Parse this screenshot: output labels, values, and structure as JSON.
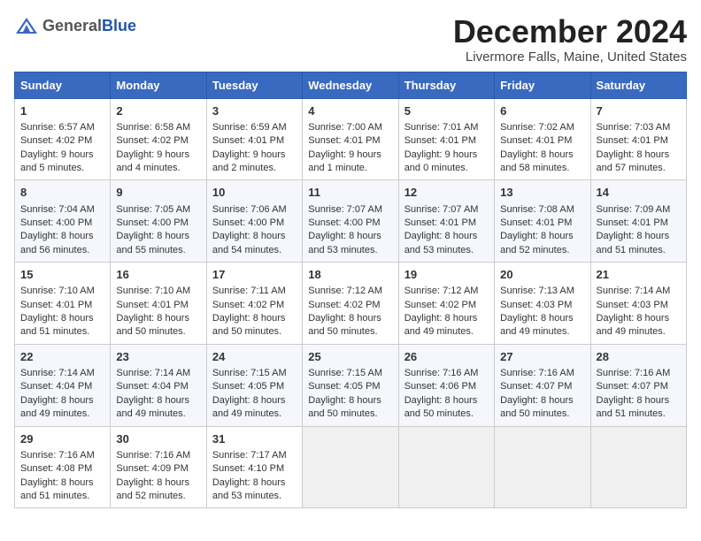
{
  "header": {
    "logo_general": "General",
    "logo_blue": "Blue",
    "title": "December 2024",
    "subtitle": "Livermore Falls, Maine, United States"
  },
  "days_of_week": [
    "Sunday",
    "Monday",
    "Tuesday",
    "Wednesday",
    "Thursday",
    "Friday",
    "Saturday"
  ],
  "weeks": [
    [
      {
        "day": 1,
        "sunrise": "6:57 AM",
        "sunset": "4:02 PM",
        "daylight": "9 hours and 5 minutes."
      },
      {
        "day": 2,
        "sunrise": "6:58 AM",
        "sunset": "4:02 PM",
        "daylight": "9 hours and 4 minutes."
      },
      {
        "day": 3,
        "sunrise": "6:59 AM",
        "sunset": "4:01 PM",
        "daylight": "9 hours and 2 minutes."
      },
      {
        "day": 4,
        "sunrise": "7:00 AM",
        "sunset": "4:01 PM",
        "daylight": "9 hours and 1 minute."
      },
      {
        "day": 5,
        "sunrise": "7:01 AM",
        "sunset": "4:01 PM",
        "daylight": "9 hours and 0 minutes."
      },
      {
        "day": 6,
        "sunrise": "7:02 AM",
        "sunset": "4:01 PM",
        "daylight": "8 hours and 58 minutes."
      },
      {
        "day": 7,
        "sunrise": "7:03 AM",
        "sunset": "4:01 PM",
        "daylight": "8 hours and 57 minutes."
      }
    ],
    [
      {
        "day": 8,
        "sunrise": "7:04 AM",
        "sunset": "4:00 PM",
        "daylight": "8 hours and 56 minutes."
      },
      {
        "day": 9,
        "sunrise": "7:05 AM",
        "sunset": "4:00 PM",
        "daylight": "8 hours and 55 minutes."
      },
      {
        "day": 10,
        "sunrise": "7:06 AM",
        "sunset": "4:00 PM",
        "daylight": "8 hours and 54 minutes."
      },
      {
        "day": 11,
        "sunrise": "7:07 AM",
        "sunset": "4:00 PM",
        "daylight": "8 hours and 53 minutes."
      },
      {
        "day": 12,
        "sunrise": "7:07 AM",
        "sunset": "4:01 PM",
        "daylight": "8 hours and 53 minutes."
      },
      {
        "day": 13,
        "sunrise": "7:08 AM",
        "sunset": "4:01 PM",
        "daylight": "8 hours and 52 minutes."
      },
      {
        "day": 14,
        "sunrise": "7:09 AM",
        "sunset": "4:01 PM",
        "daylight": "8 hours and 51 minutes."
      }
    ],
    [
      {
        "day": 15,
        "sunrise": "7:10 AM",
        "sunset": "4:01 PM",
        "daylight": "8 hours and 51 minutes."
      },
      {
        "day": 16,
        "sunrise": "7:10 AM",
        "sunset": "4:01 PM",
        "daylight": "8 hours and 50 minutes."
      },
      {
        "day": 17,
        "sunrise": "7:11 AM",
        "sunset": "4:02 PM",
        "daylight": "8 hours and 50 minutes."
      },
      {
        "day": 18,
        "sunrise": "7:12 AM",
        "sunset": "4:02 PM",
        "daylight": "8 hours and 50 minutes."
      },
      {
        "day": 19,
        "sunrise": "7:12 AM",
        "sunset": "4:02 PM",
        "daylight": "8 hours and 49 minutes."
      },
      {
        "day": 20,
        "sunrise": "7:13 AM",
        "sunset": "4:03 PM",
        "daylight": "8 hours and 49 minutes."
      },
      {
        "day": 21,
        "sunrise": "7:14 AM",
        "sunset": "4:03 PM",
        "daylight": "8 hours and 49 minutes."
      }
    ],
    [
      {
        "day": 22,
        "sunrise": "7:14 AM",
        "sunset": "4:04 PM",
        "daylight": "8 hours and 49 minutes."
      },
      {
        "day": 23,
        "sunrise": "7:14 AM",
        "sunset": "4:04 PM",
        "daylight": "8 hours and 49 minutes."
      },
      {
        "day": 24,
        "sunrise": "7:15 AM",
        "sunset": "4:05 PM",
        "daylight": "8 hours and 49 minutes."
      },
      {
        "day": 25,
        "sunrise": "7:15 AM",
        "sunset": "4:05 PM",
        "daylight": "8 hours and 50 minutes."
      },
      {
        "day": 26,
        "sunrise": "7:16 AM",
        "sunset": "4:06 PM",
        "daylight": "8 hours and 50 minutes."
      },
      {
        "day": 27,
        "sunrise": "7:16 AM",
        "sunset": "4:07 PM",
        "daylight": "8 hours and 50 minutes."
      },
      {
        "day": 28,
        "sunrise": "7:16 AM",
        "sunset": "4:07 PM",
        "daylight": "8 hours and 51 minutes."
      }
    ],
    [
      {
        "day": 29,
        "sunrise": "7:16 AM",
        "sunset": "4:08 PM",
        "daylight": "8 hours and 51 minutes."
      },
      {
        "day": 30,
        "sunrise": "7:16 AM",
        "sunset": "4:09 PM",
        "daylight": "8 hours and 52 minutes."
      },
      {
        "day": 31,
        "sunrise": "7:17 AM",
        "sunset": "4:10 PM",
        "daylight": "8 hours and 53 minutes."
      },
      null,
      null,
      null,
      null
    ]
  ],
  "labels": {
    "sunrise": "Sunrise:",
    "sunset": "Sunset:",
    "daylight": "Daylight:"
  }
}
